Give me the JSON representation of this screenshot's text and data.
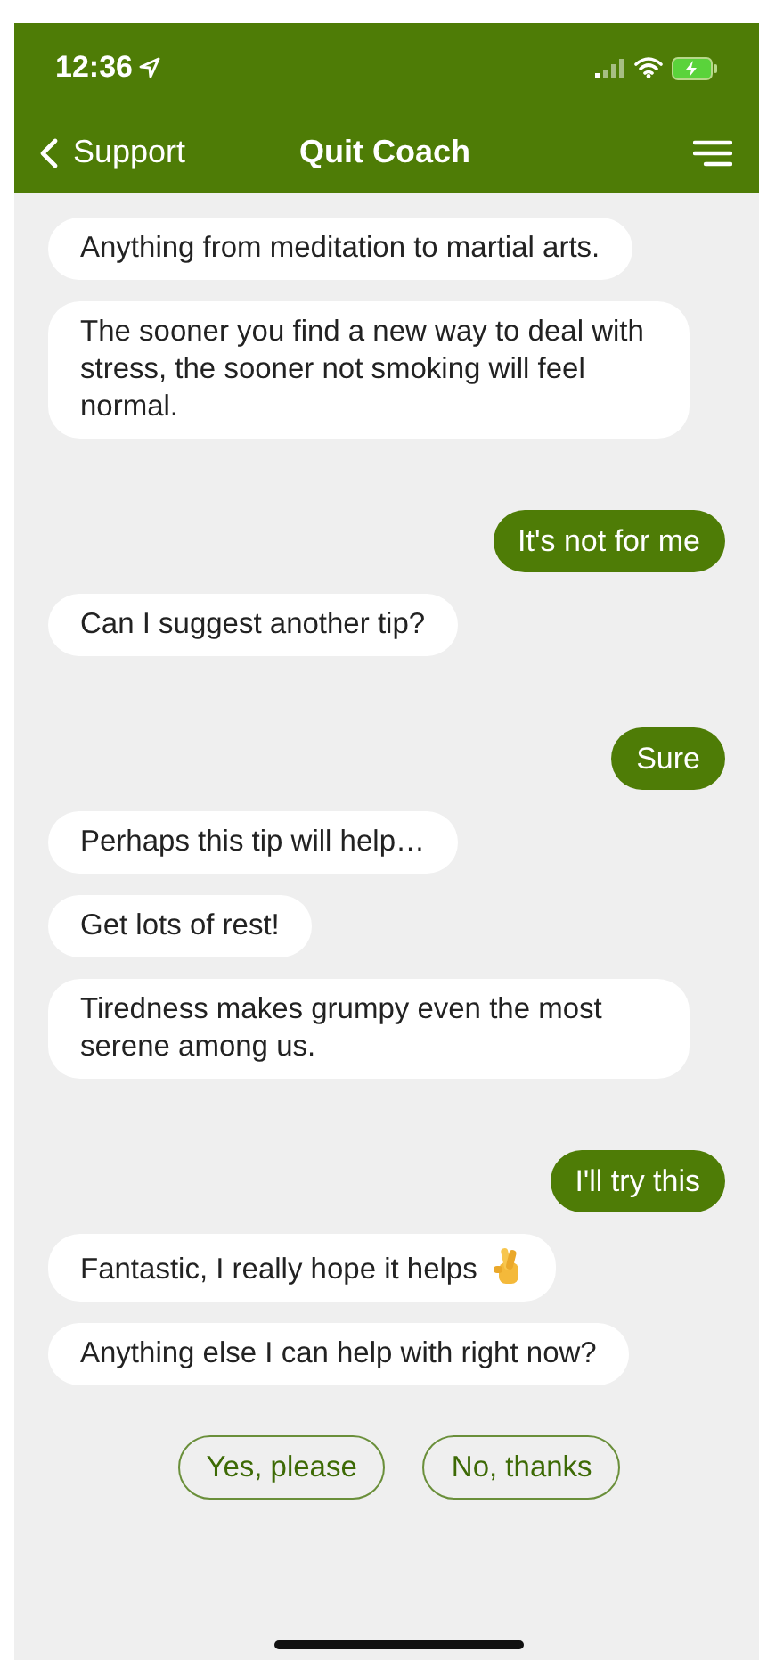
{
  "status_bar": {
    "time": "12:36"
  },
  "nav": {
    "back": "Support",
    "title": "Quit Coach"
  },
  "messages": [
    {
      "kind": "bot",
      "text": "Anything from meditation to martial arts."
    },
    {
      "kind": "bot",
      "text": "The sooner you find a new way to deal with stress, the sooner not smoking will feel normal."
    },
    {
      "kind": "user",
      "text": "It's not for me"
    },
    {
      "kind": "bot",
      "text": "Can I suggest another tip?"
    },
    {
      "kind": "user",
      "text": "Sure"
    },
    {
      "kind": "bot",
      "text": "Perhaps this tip will help…"
    },
    {
      "kind": "bot",
      "text": "Get lots of rest!"
    },
    {
      "kind": "bot",
      "text": "Tiredness makes grumpy even the most serene among us."
    },
    {
      "kind": "user",
      "text": "I'll try this"
    },
    {
      "kind": "bot_emoji",
      "text": "Fantastic, I really hope it helps"
    },
    {
      "kind": "bot",
      "text": "Anything else I can help with right now?"
    }
  ],
  "replies": [
    "Yes, please",
    "No, thanks"
  ]
}
